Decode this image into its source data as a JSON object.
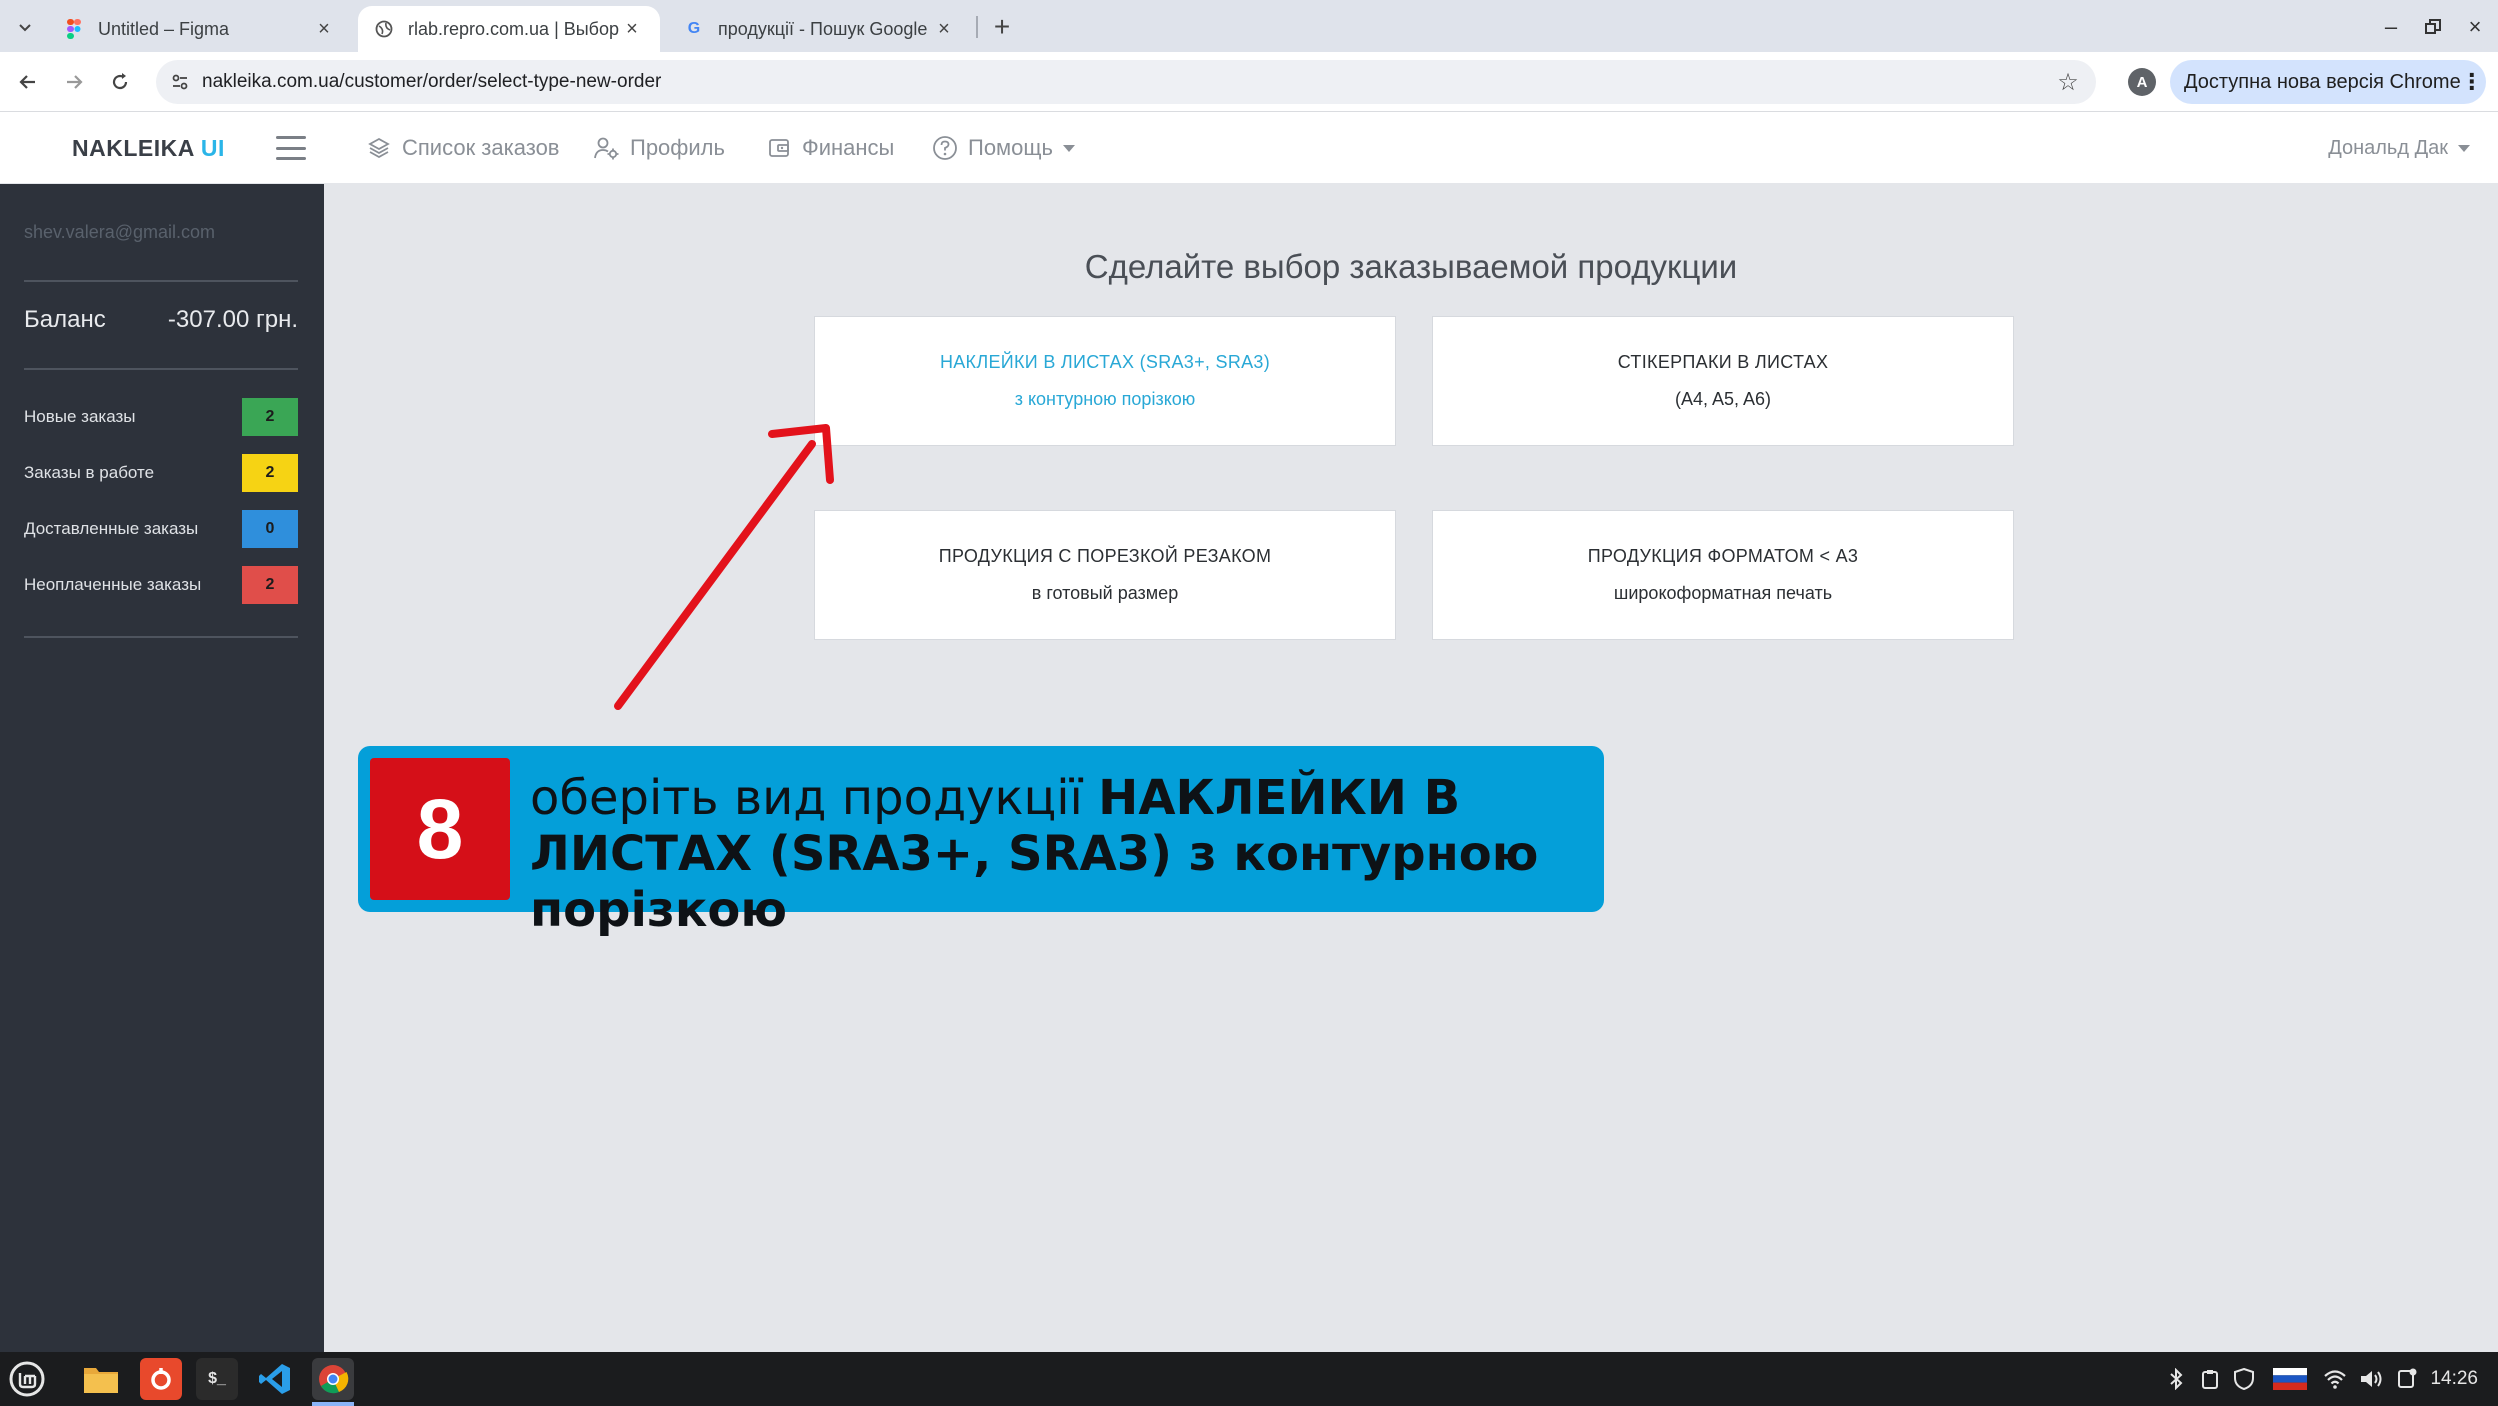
{
  "browser": {
    "tabs": [
      {
        "title": "Untitled – Figma",
        "favicon": "figma-icon",
        "active": false
      },
      {
        "title": "rlab.repro.com.ua | Выбор т",
        "favicon": "globe-icon",
        "active": true
      },
      {
        "title": "продукції - Пошук Google",
        "favicon": "google-icon",
        "active": false
      }
    ],
    "url": "nakleika.com.ua/customer/order/select-type-new-order",
    "profile_initial": "A",
    "update_button": "Доступна нова версія Chrome"
  },
  "navbar": {
    "brand_main": "NAKLEIKA",
    "brand_accent": "UI",
    "items": [
      {
        "label": "Список заказов",
        "icon": "layers-icon"
      },
      {
        "label": "Профиль",
        "icon": "user-cog-icon"
      },
      {
        "label": "Финансы",
        "icon": "wallet-icon"
      },
      {
        "label": "Помощь",
        "icon": "help-circle-icon"
      }
    ],
    "user": "Дональд Дак"
  },
  "sidebar": {
    "email": "shev.valera@gmail.com",
    "balance_label": "Баланс",
    "balance_value": "-307.00 грн.",
    "stats": [
      {
        "label": "Новые заказы",
        "count": "2",
        "color": "#3aa655",
        "text_color": "#1c1c1c"
      },
      {
        "label": "Заказы в работе",
        "count": "2",
        "color": "#f6d314",
        "text_color": "#1c1c1c"
      },
      {
        "label": "Доставленные заказы",
        "count": "0",
        "color": "#2f8fdc",
        "text_color": "#1c1c1c"
      },
      {
        "label": "Неоплаченные заказы",
        "count": "2",
        "color": "#e04e4a",
        "text_color": "#1c1c1c"
      }
    ]
  },
  "main": {
    "title": "Сделайте выбор заказываемой продукции",
    "cards": [
      {
        "line1": "НАКЛЕЙКИ В ЛИСТАХ (SRA3+, SRA3)",
        "line2": "з контурною порізкою",
        "selected": true
      },
      {
        "line1": "СТІКЕРПАКИ В ЛИСТАХ",
        "line2": "(A4, A5, A6)",
        "selected": false
      },
      {
        "line1": "ПРОДУКЦИЯ С ПОРЕЗКОЙ РЕЗАКОМ",
        "line2": "в готовый размер",
        "selected": false
      },
      {
        "line1": "ПРОДУКЦИЯ ФОРМАТОМ < A3",
        "line2": "широкоформатная печать",
        "selected": false
      }
    ]
  },
  "annotation": {
    "step": "8",
    "text_normal": "оберіть вид продукції ",
    "text_bold": "НАКЛЕЙКИ В ЛИСТАХ (SRA3+, SRA3) з контурною порізкою",
    "colors": {
      "box": "#049fd9",
      "number_box": "#d50f18",
      "arrow": "#e3121b"
    }
  },
  "taskbar": {
    "apps": [
      "mint-menu-icon",
      "files-icon",
      "app-red-icon",
      "terminal-icon",
      "vscode-icon",
      "chrome-icon"
    ],
    "tray": [
      "bluetooth-icon",
      "clipboard-icon",
      "shield-icon",
      "flag-ru-icon",
      "wifi-icon",
      "volume-icon",
      "notification-icon"
    ],
    "clock": "14:26"
  }
}
